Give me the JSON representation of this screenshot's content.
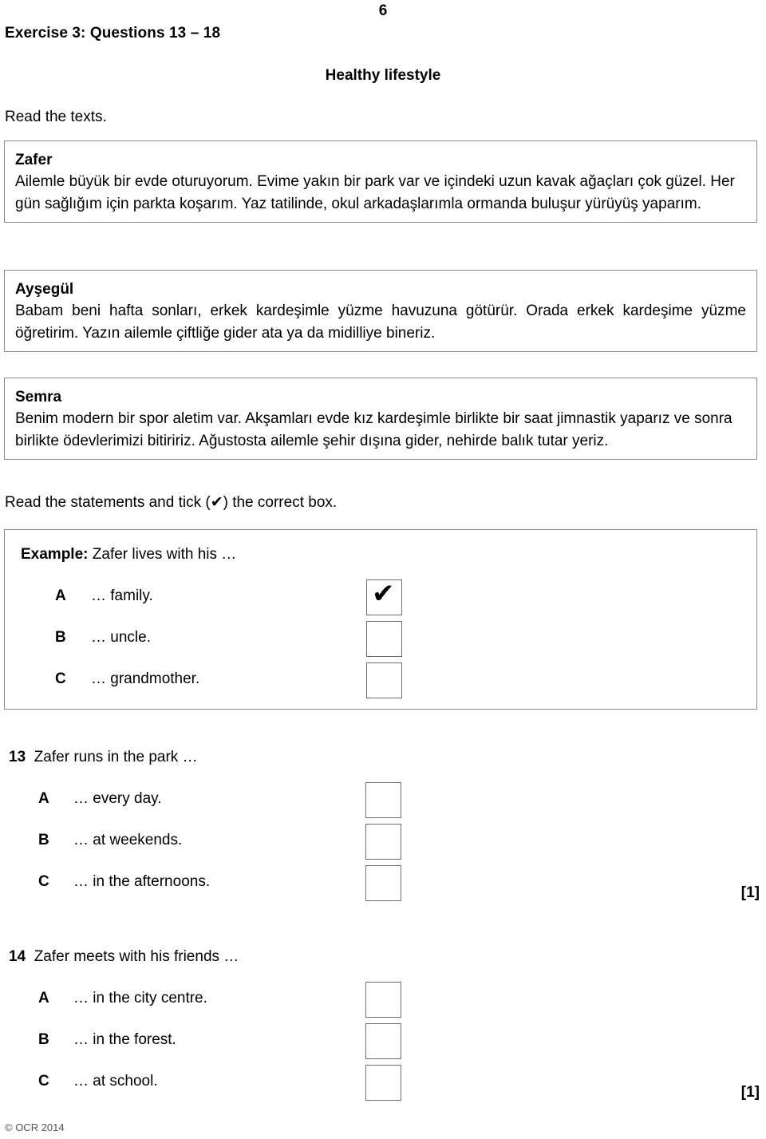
{
  "header": {
    "page_number": "6",
    "exercise_heading": "Exercise 3: Questions 13 – 18",
    "section_title": "Healthy lifestyle",
    "read_texts": "Read the texts."
  },
  "texts": [
    {
      "name": "Zafer",
      "body": "Ailemle büyük bir evde oturuyorum. Evime yakın bir park var ve içindeki uzun kavak ağaçları çok güzel. Her gün sağlığım için parkta koşarım. Yaz tatilinde, okul arkadaşlarımla ormanda buluşur yürüyüş yaparım."
    },
    {
      "name": "Ayşegül",
      "body": "Babam beni hafta sonları, erkek kardeşimle yüzme havuzuna götürür. Orada erkek kardeşime yüzme öğretirim. Yazın ailemle çiftliğe gider ata ya da midilliye bineriz."
    },
    {
      "name": "Semra",
      "body": "Benim modern bir spor aletim var. Akşamları evde kız kardeşimle birlikte bir saat jimnastik yaparız ve sonra birlikte ödevlerimizi bitiririz. Ağustosta ailemle şehir dışına gider, nehirde balık tutar yeriz."
    }
  ],
  "instruction": "Read the statements and tick (✔) the correct box.",
  "example": {
    "label": "Example:",
    "stem": "Zafer lives with his …",
    "options": [
      {
        "letter": "A",
        "text": "… family.",
        "ticked": "✔"
      },
      {
        "letter": "B",
        "text": "… uncle.",
        "ticked": ""
      },
      {
        "letter": "C",
        "text": "… grandmother.",
        "ticked": ""
      }
    ]
  },
  "questions": [
    {
      "number": "13",
      "stem": "Zafer runs in the park …",
      "marks": "[1]",
      "options": [
        {
          "letter": "A",
          "text": "… every day.",
          "ticked": ""
        },
        {
          "letter": "B",
          "text": "… at weekends.",
          "ticked": ""
        },
        {
          "letter": "C",
          "text": "… in the afternoons.",
          "ticked": ""
        }
      ]
    },
    {
      "number": "14",
      "stem": "Zafer meets with his friends …",
      "marks": "[1]",
      "options": [
        {
          "letter": "A",
          "text": "… in the city centre.",
          "ticked": ""
        },
        {
          "letter": "B",
          "text": "… in the forest.",
          "ticked": ""
        },
        {
          "letter": "C",
          "text": "… at school.",
          "ticked": ""
        }
      ]
    }
  ],
  "footer": {
    "copyright": "© OCR 2014"
  },
  "colors": {
    "text": "#000000",
    "box_border": "#8c8c8c",
    "checkbox_border": "#6e6e6e",
    "background": "#ffffff"
  }
}
